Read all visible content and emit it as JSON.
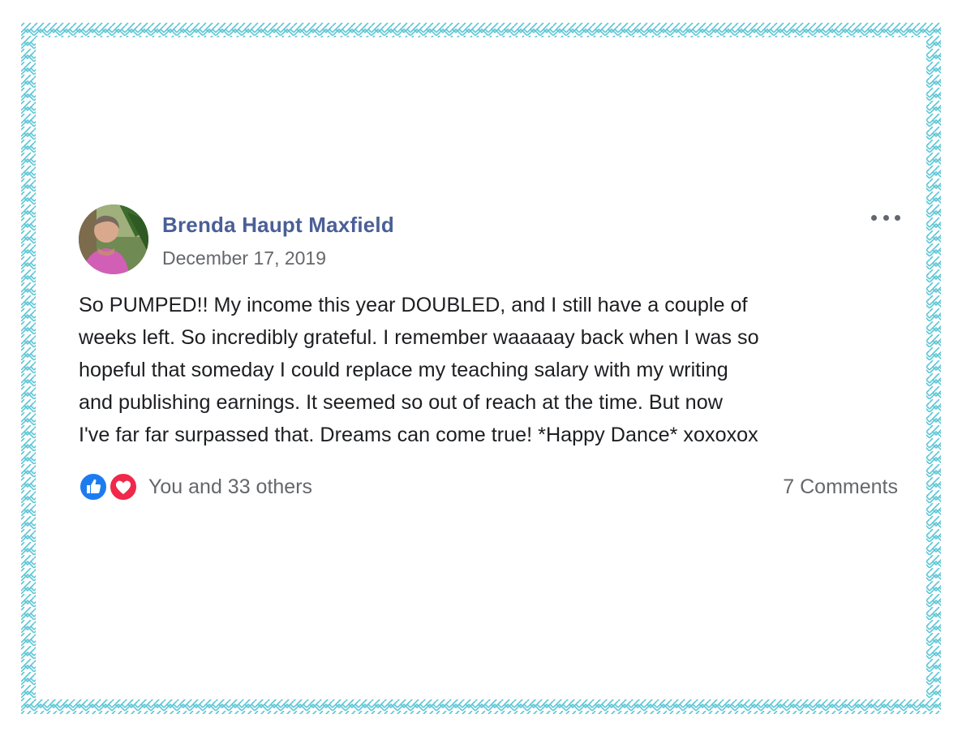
{
  "post": {
    "author": "Brenda Haupt Maxfield",
    "date": "December 17, 2019",
    "text": "So PUMPED!! My income this year DOUBLED, and I still have a couple of\nweeks left. So incredibly grateful. I remember waaaaay back when I was so\nhopeful that someday I could replace my teaching salary with my writing\nand publishing earnings. It seemed so out of reach at the time. But now\nI've far far surpassed that. Dreams can come true! *Happy Dance* xoxoxox",
    "reactions_text": "You and 33 others",
    "comments_text": "7 Comments"
  },
  "icons": {
    "more": "more-options-icon",
    "like": "like-reaction-icon",
    "love": "love-reaction-icon",
    "avatar": "avatar"
  },
  "colors": {
    "border_pattern": "#5cc6d6",
    "author_link": "#4a5f96",
    "secondary_text": "#65676b",
    "body_text": "#1c1e21",
    "like_blue": "#1d7bf0",
    "love_red": "#f0284a"
  }
}
